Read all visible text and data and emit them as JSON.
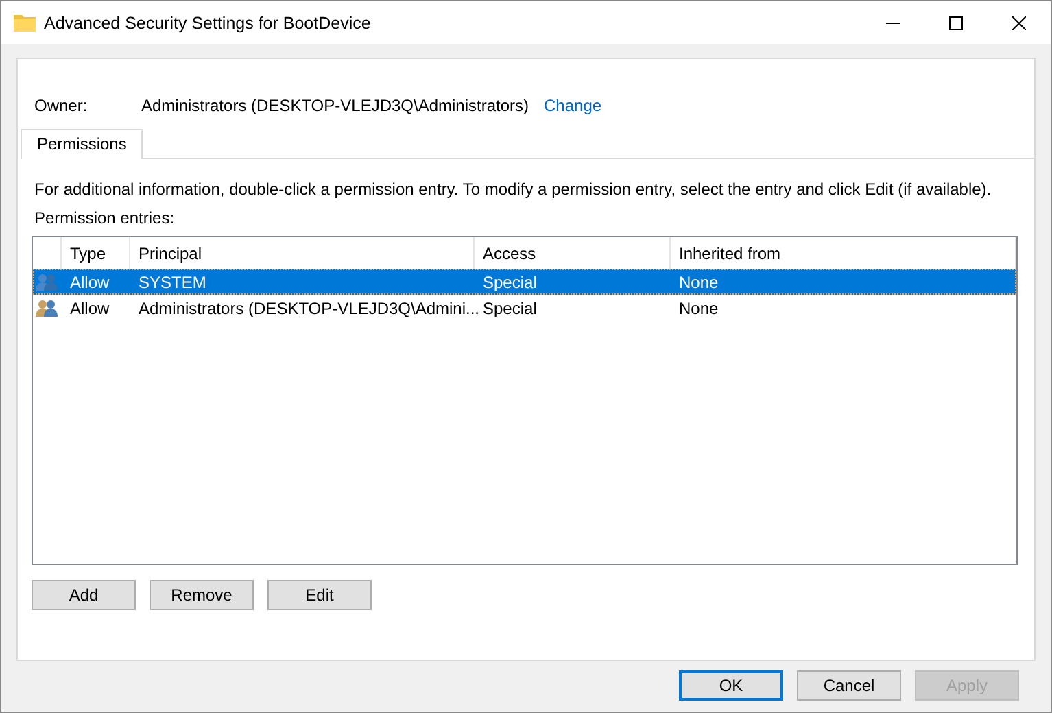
{
  "window": {
    "title": "Advanced Security Settings for BootDevice"
  },
  "owner": {
    "label": "Owner:",
    "value": "Administrators (DESKTOP-VLEJD3Q\\Administrators)",
    "link": "Change"
  },
  "tabs": [
    {
      "label": "Permissions",
      "selected": true
    }
  ],
  "info": "For additional information, double-click a permission entry. To modify a permission entry, select the entry and click Edit (if available).",
  "entries_label": "Permission entries:",
  "table": {
    "columns": [
      "Type",
      "Principal",
      "Access",
      "Inherited from"
    ],
    "rows": [
      {
        "type": "Allow",
        "principal": "SYSTEM",
        "access": "Special",
        "inherited": "None",
        "selected": true
      },
      {
        "type": "Allow",
        "principal": "Administrators (DESKTOP-VLEJD3Q\\Admini...",
        "access": "Special",
        "inherited": "None",
        "selected": false
      }
    ]
  },
  "entry_buttons": [
    {
      "label": "Add",
      "disabled": false
    },
    {
      "label": "Remove",
      "disabled": false
    },
    {
      "label": "Edit",
      "disabled": false
    }
  ],
  "dialog_buttons": [
    {
      "label": "OK",
      "default": true,
      "disabled": false
    },
    {
      "label": "Cancel",
      "default": false,
      "disabled": false
    },
    {
      "label": "Apply",
      "default": false,
      "disabled": true
    }
  ]
}
